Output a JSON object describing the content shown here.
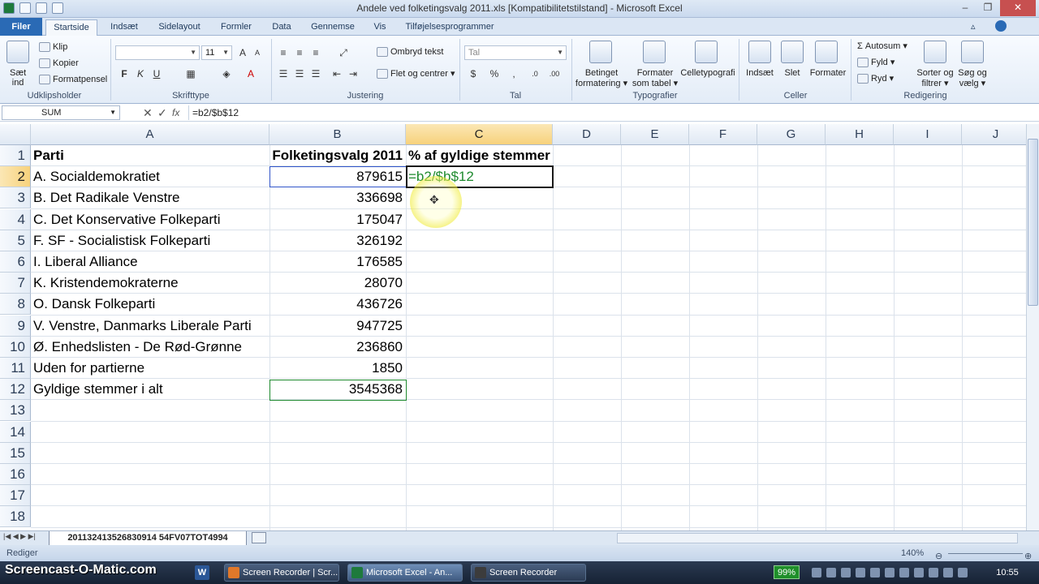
{
  "window": {
    "title": "Andele ved folketingsvalg 2011.xls  [Kompatibilitetstilstand]  -  Microsoft Excel"
  },
  "ribbon_tabs": {
    "filer": "Filer",
    "items": [
      "Startside",
      "Indsæt",
      "Sidelayout",
      "Formler",
      "Data",
      "Gennemse",
      "Vis",
      "Tilføjelsesprogrammer"
    ]
  },
  "ribbon": {
    "clipboard": {
      "paste": "Sæt",
      "paste2": "ind",
      "cut": "Klip",
      "copy": "Kopier",
      "format_painter": "Formatpensel",
      "label": "Udklipsholder"
    },
    "font": {
      "font_name": "",
      "font_size": "11",
      "bold": "F",
      "italic": "K",
      "underline": "U",
      "label": "Skrifttype"
    },
    "alignment": {
      "wrap": "Ombryd tekst",
      "merge": "Flet og centrer",
      "label": "Justering"
    },
    "number": {
      "format": "Tal",
      "label": "Tal"
    },
    "styles": {
      "conditional": "Betinget",
      "conditional2": "formatering",
      "as_table": "Formater",
      "as_table2": "som tabel",
      "cell_styles": "Celletypografi",
      "label": "Typografier"
    },
    "cells": {
      "insert": "Indsæt",
      "delete": "Slet",
      "format": "Formater",
      "label": "Celler"
    },
    "editing": {
      "autosum": "Autosum",
      "fill": "Fyld",
      "clear": "Ryd",
      "sort": "Sorter og",
      "sort2": "filtrer",
      "find": "Søg og",
      "find2": "vælg",
      "label": "Redigering"
    }
  },
  "formula_bar": {
    "name_box": "SUM",
    "cancel": "✕",
    "enter": "✓",
    "fx": "fx",
    "formula": "=b2/$b$12"
  },
  "columns": [
    "A",
    "B",
    "C",
    "D",
    "E",
    "F",
    "G",
    "H",
    "I",
    "J"
  ],
  "rows": [
    "1",
    "2",
    "3",
    "4",
    "5",
    "6",
    "7",
    "8",
    "9",
    "10",
    "11",
    "12",
    "13",
    "14",
    "15",
    "16",
    "17",
    "18"
  ],
  "sheet": {
    "header": {
      "a": "Parti",
      "b": "Folketingsvalg 2011",
      "c": "% af gyldige stemmer"
    },
    "data": [
      {
        "party": "A. Socialdemokratiet",
        "votes": "879615"
      },
      {
        "party": "B. Det Radikale Venstre",
        "votes": "336698"
      },
      {
        "party": "C. Det Konservative Folkeparti",
        "votes": "175047"
      },
      {
        "party": "F. SF - Socialistisk Folkeparti",
        "votes": "326192"
      },
      {
        "party": "I. Liberal Alliance",
        "votes": "176585"
      },
      {
        "party": "K. Kristendemokraterne",
        "votes": "28070"
      },
      {
        "party": "O. Dansk Folkeparti",
        "votes": "436726"
      },
      {
        "party": "V. Venstre, Danmarks Liberale Parti",
        "votes": "947725"
      },
      {
        "party": "Ø. Enhedslisten - De Rød-Grønne",
        "votes": "236860"
      },
      {
        "party": "Uden for partierne",
        "votes": "1850"
      },
      {
        "party": "Gyldige stemmer i alt",
        "votes": "3545368"
      }
    ],
    "active_cell_edit": "=b2/$b$12"
  },
  "sheet_tab": "201132413526830914 54FV07TOT4994",
  "status": {
    "mode": "Rediger",
    "zoom": "140%"
  },
  "taskbar": {
    "watermark": "Screencast-O-Matic.com",
    "tasks": [
      "Screen Recorder | Scr...",
      "Microsoft Excel - An...",
      "Screen Recorder"
    ],
    "battery": "99%",
    "clock": "10:55"
  },
  "colors": {
    "accent": "#2a6ab5",
    "selection": "#f7d27c",
    "formula_ref_b2": "#3155c9",
    "formula_ref_b12": "#1e8a2e"
  }
}
